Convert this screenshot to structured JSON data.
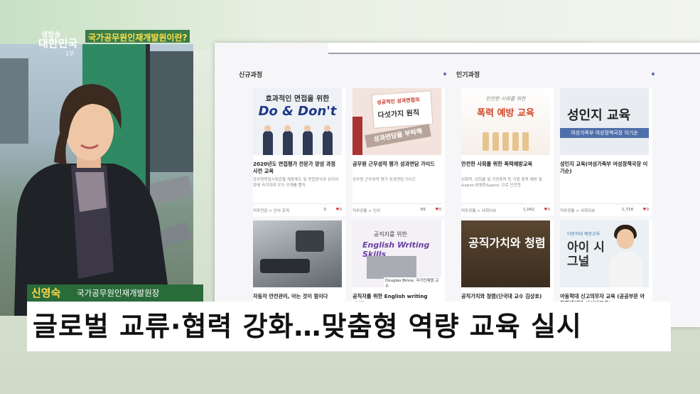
{
  "broadcast": {
    "logo": {
      "line1": "생방송",
      "line2": "대한민국",
      "line3": "1부"
    },
    "topic": "국가공무원인재개발원이란?",
    "guest_name": "신영숙",
    "guest_role": "국가공무원인재개발원장",
    "headline": "글로벌 교류·협력 강화…맞춤형 역량 교육 실시"
  },
  "website": {
    "sections": [
      {
        "label": "신규과정"
      },
      {
        "label": "인기과정"
      }
    ],
    "cards_row1": [
      {
        "thumb_top": "효과적인 면접을 위한",
        "thumb_main": "Do & Don't",
        "title": "2020년도 면접평가 전문가 양성 과정 사전 교육",
        "desc": "공무원면접시험관들 채용제도 및 면접방식과 유의사항에 숙지하여 우수 인재를 뽑자",
        "category": "직무전문 > 인사 조직",
        "views": "0",
        "likes": "0"
      },
      {
        "thumb_top": "성공적인 성과면접의",
        "thumb_main": "다섯가지 원칙",
        "thumb_stamp": "성과면담을 부탁해",
        "title": "공무원 근무성적 평가 성과면담 가이드",
        "desc": "공무원 근무성적 평가 성과면담 가이드",
        "category": "직무공통 > 인사",
        "views": "65",
        "likes": "0"
      },
      {
        "thumb_top": "안전한 사회를 위한",
        "thumb_main": "폭력 예방 교육",
        "title": "안전한 사회를 위한 폭력예방교육",
        "desc": "성폭력, 성희롱 및 가정폭력 등 각종 폭력 예방 및 &apos;성평등&apos; 으로 안전한",
        "category": "직무공통 > 사회이슈",
        "views": "1,042",
        "likes": "0"
      },
      {
        "thumb_main": "성인지 교육",
        "thumb_band": "여성가족부 여성정책국장 이기순",
        "title": "성인지 교육(여성가족부 여성정책국장 이기순)",
        "desc": "",
        "category": "직무공통 > 사회이슈",
        "views": "1,718",
        "likes": "0"
      }
    ],
    "cards_row2": [
      {
        "title": "자동차 안전관리, 아는 것이 힘이다"
      },
      {
        "thumb_top": "공직자를 위한",
        "thumb_main": "English Writing Skills",
        "thumb_caption": "Douglas Binne, 국가인재원 교수",
        "title": "공직자를 위한 English writing skills"
      },
      {
        "thumb_main": "공직가치와 청렴",
        "title": "공직가치와 청렴(단국대 교수 김상호)"
      },
      {
        "thumb_tag": "아동학대 예방교육",
        "thumb_main": "아이 시그널",
        "title": "아동학대 신고의무자 교육 (공공부문 아동학대예방 사이버교육)"
      }
    ]
  },
  "colors": {
    "strap_green": "#2a6b3a",
    "name_yellow": "#ffd84a",
    "topic_yellow": "#ffe14a",
    "accent_blue": "#5a6db5"
  }
}
